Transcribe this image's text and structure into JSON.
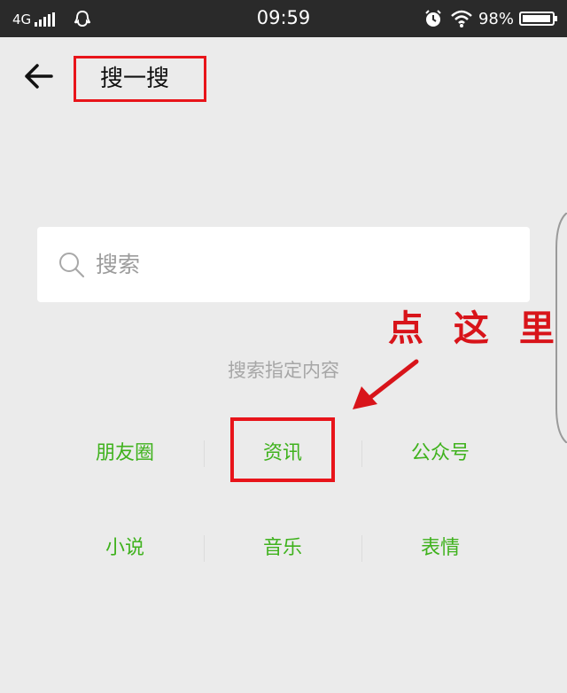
{
  "status_bar": {
    "network": "4G",
    "time": "09:59",
    "battery": "98%",
    "battery_level": 0.98,
    "icons": [
      "signal-icon",
      "qq-icon",
      "alarm-icon",
      "wifi-icon",
      "battery-icon"
    ]
  },
  "header": {
    "title": "搜一搜",
    "back_icon": "arrow-left-icon"
  },
  "search": {
    "placeholder": "搜索",
    "icon": "search-icon"
  },
  "annotation": {
    "text": "点 这 里",
    "color": "#d8141a"
  },
  "hint": "搜索指定内容",
  "categories": [
    {
      "label": "朋友圈"
    },
    {
      "label": "资讯"
    },
    {
      "label": "公众号"
    },
    {
      "label": "小说"
    },
    {
      "label": "音乐"
    },
    {
      "label": "表情"
    }
  ],
  "colors": {
    "accent_green": "#3fb21d",
    "highlight_red": "#e8141a",
    "background": "#ebebeb",
    "status_bar": "#2a2a2a"
  }
}
